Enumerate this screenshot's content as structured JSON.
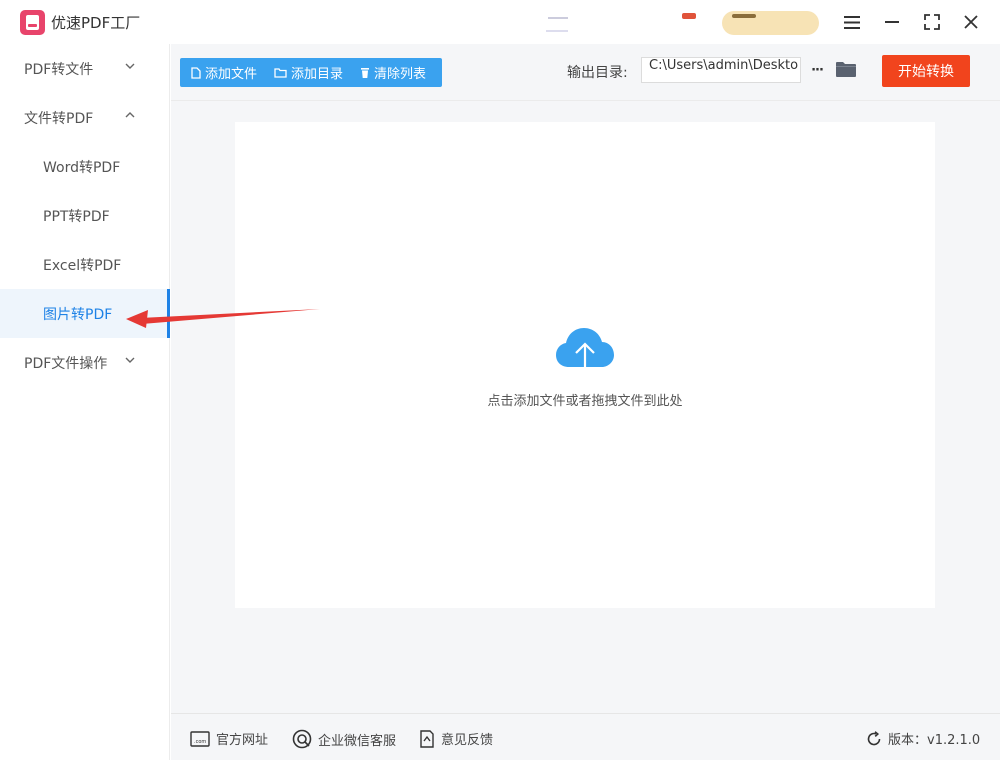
{
  "app": {
    "title": "优速PDF工厂"
  },
  "sidebar": {
    "items": [
      {
        "label": "PDF转文件",
        "type": "group",
        "expanded": false
      },
      {
        "label": "文件转PDF",
        "type": "group",
        "expanded": true
      },
      {
        "label": "Word转PDF",
        "type": "sub"
      },
      {
        "label": "PPT转PDF",
        "type": "sub"
      },
      {
        "label": "Excel转PDF",
        "type": "sub"
      },
      {
        "label": "图片转PDF",
        "type": "sub",
        "active": true
      },
      {
        "label": "PDF文件操作",
        "type": "group",
        "expanded": false
      }
    ]
  },
  "toolbar": {
    "add_file": "添加文件",
    "add_dir": "添加目录",
    "clear_list": "清除列表",
    "output_label": "输出目录:",
    "output_path": "C:\\Users\\admin\\Deskto",
    "more_label": "···",
    "start": "开始转换"
  },
  "dropzone": {
    "hint": "点击添加文件或者拖拽文件到此处"
  },
  "footer": {
    "website": "官方网址",
    "wechat": "企业微信客服",
    "feedback": "意见反馈",
    "version": "版本：v1.2.1.0"
  },
  "colors": {
    "accent": "#3aa2ef",
    "active_nav": "#1e82e6",
    "start_button": "#f1441d",
    "annotation_arrow": "#e53935",
    "logo": "#e8446b"
  },
  "icons": [
    "pdf-logo-icon",
    "menu-icon",
    "minimize-icon",
    "fullscreen-icon",
    "close-icon",
    "file-icon",
    "folder-icon",
    "trash-icon",
    "cloud-upload-icon",
    "website-icon",
    "chat-icon",
    "feedback-icon",
    "refresh-icon"
  ]
}
